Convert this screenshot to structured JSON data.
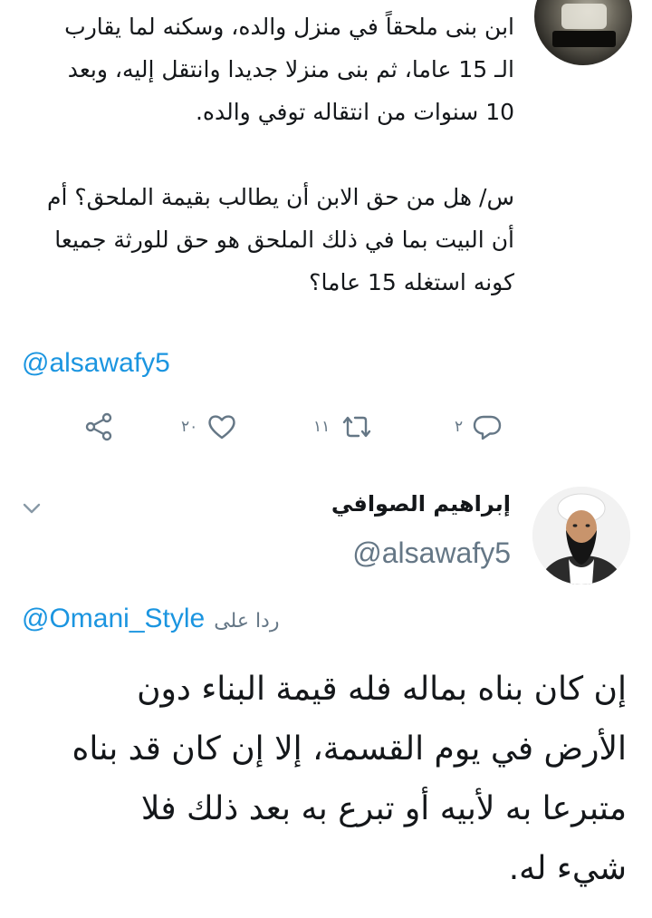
{
  "tweet1": {
    "text": "ابن بنى ملحقاً في منزل والده، وسكنه لما يقارب\nالـ 15 عاما، ثم بنى منزلا جديدا وانتقل إليه، وبعد\n10 سنوات من انتقاله توفي والده.\n\nس/ هل من حق الابن أن يطالب بقيمة الملحق؟ أم\nأن البيت بما في ذلك الملحق هو حق للورثة جميعا\nكونه استغله 15 عاما؟",
    "mention": "@alsawafy5",
    "actions": {
      "reply_count": "٢",
      "retweet_count": "١١",
      "like_count": "٢٠"
    }
  },
  "tweet2": {
    "display_name": "إبراهيم الصوافي",
    "handle": "@alsawafy5",
    "replying_to_label": "ردا على",
    "replying_to_mention": "@Omani_Style",
    "text": "إن كان بناه بماله فله قيمة البناء دون\nالأرض في يوم القسمة، إلا إن كان قد بناه\nمتبرعا به لأبيه أو تبرع به بعد ذلك فلا\nشيء له."
  },
  "colors": {
    "link": "#1b95e0",
    "secondary_text": "#657786",
    "primary_text": "#14171a"
  },
  "icons": {
    "reply": "reply-icon",
    "retweet": "retweet-icon",
    "like": "heart-icon",
    "share": "share-icon",
    "more": "chevron-down-icon"
  }
}
